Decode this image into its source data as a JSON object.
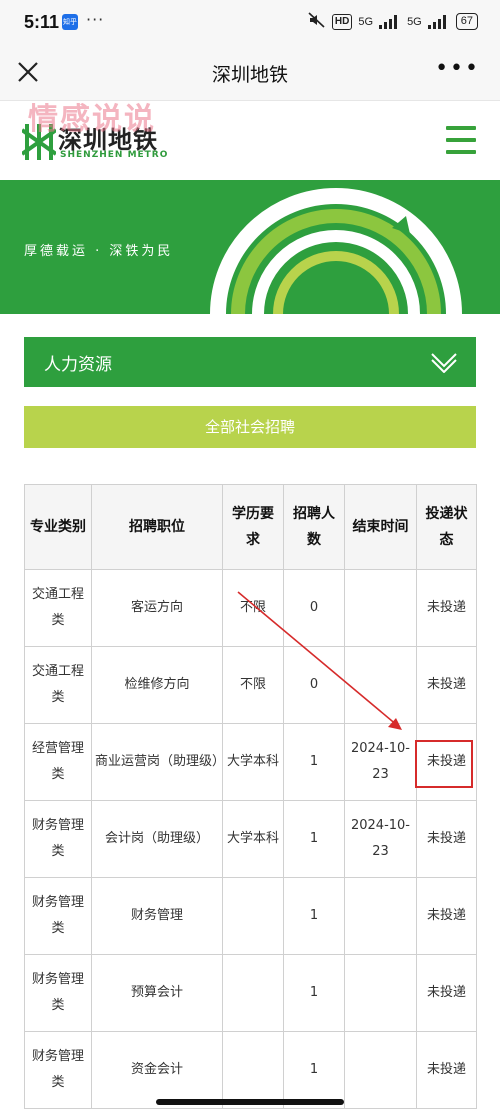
{
  "status_bar": {
    "time": "5:11",
    "app_badge": "知乎",
    "dots": "···",
    "hd_label": "HD",
    "network_1": "5G",
    "network_2": "5G",
    "battery": "67"
  },
  "navbar": {
    "title": "深圳地铁",
    "close_icon": "close-icon",
    "more_icon": "more-icon",
    "more_glyph": "•••"
  },
  "watermark": "情感说说",
  "brand": {
    "name_cn": "深圳地铁",
    "name_en": "SHENZHEN METRO",
    "logo_color": "#2e9f3e"
  },
  "banner": {
    "slogan": "厚德载运 · 深铁为民",
    "bg_color": "#2e9f3e"
  },
  "section": {
    "label": "人力资源"
  },
  "all_button": {
    "label": "全部社会招聘",
    "color": "#b8d34c"
  },
  "table": {
    "headers": [
      "专业类别",
      "招聘职位",
      "学历要求",
      "招聘人数",
      "结束时间",
      "投递状态"
    ],
    "rows": [
      {
        "category": "交通工程类",
        "position": "客运方向",
        "education": "不限",
        "count": "0",
        "end_time": "",
        "status": "未投递"
      },
      {
        "category": "交通工程类",
        "position": "检维修方向",
        "education": "不限",
        "count": "0",
        "end_time": "",
        "status": "未投递"
      },
      {
        "category": "经营管理类",
        "position": "商业运营岗（助理级）",
        "education": "大学本科",
        "count": "1",
        "end_time": "2024-10-23",
        "status": "未投递"
      },
      {
        "category": "财务管理类",
        "position": "会计岗（助理级）",
        "education": "大学本科",
        "count": "1",
        "end_time": "2024-10-23",
        "status": "未投递"
      },
      {
        "category": "财务管理类",
        "position": "财务管理",
        "education": "",
        "count": "1",
        "end_time": "",
        "status": "未投递"
      },
      {
        "category": "财务管理类",
        "position": "预算会计",
        "education": "",
        "count": "1",
        "end_time": "",
        "status": "未投递"
      },
      {
        "category": "财务管理类",
        "position": "资金会计",
        "education": "",
        "count": "1",
        "end_time": "",
        "status": "未投递"
      }
    ],
    "status_color": "#c0392b"
  },
  "annotation": {
    "arrow_color": "#d62b2b"
  }
}
